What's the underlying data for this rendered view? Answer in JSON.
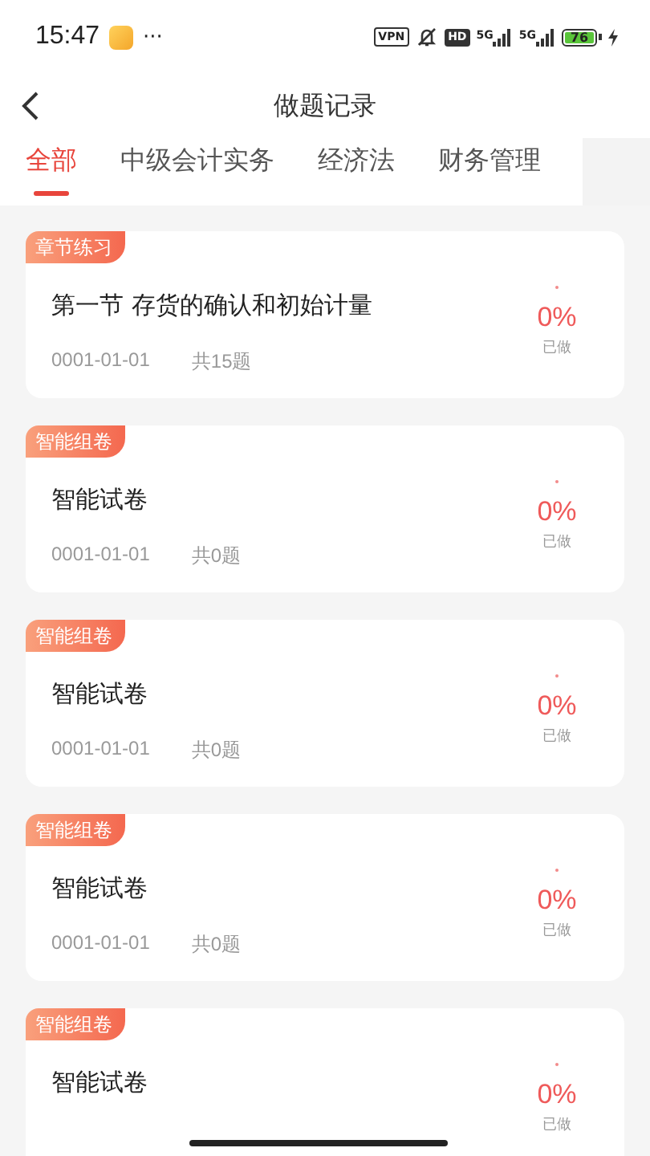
{
  "status_bar": {
    "time": "15:47",
    "more": "···",
    "vpn": "VPN",
    "hd": "HD",
    "networks": [
      "5G",
      "5G"
    ],
    "battery": "76"
  },
  "header": {
    "title": "做题记录"
  },
  "tabs": [
    {
      "label": "全部",
      "selected": true
    },
    {
      "label": "中级会计实务",
      "selected": false
    },
    {
      "label": "经济法",
      "selected": false
    },
    {
      "label": "财务管理",
      "selected": false
    }
  ],
  "records": [
    {
      "tag": "章节练习",
      "title": "第一节 存货的确认和初始计量",
      "date": "0001-01-01",
      "count": "共15题",
      "percent": "0%",
      "status": "已做"
    },
    {
      "tag": "智能组卷",
      "title": "智能试卷",
      "date": "0001-01-01",
      "count": "共0题",
      "percent": "0%",
      "status": "已做"
    },
    {
      "tag": "智能组卷",
      "title": "智能试卷",
      "date": "0001-01-01",
      "count": "共0题",
      "percent": "0%",
      "status": "已做"
    },
    {
      "tag": "智能组卷",
      "title": "智能试卷",
      "date": "0001-01-01",
      "count": "共0题",
      "percent": "0%",
      "status": "已做"
    },
    {
      "tag": "智能组卷",
      "title": "智能试卷",
      "percent": "0%",
      "status": "已做"
    }
  ]
}
